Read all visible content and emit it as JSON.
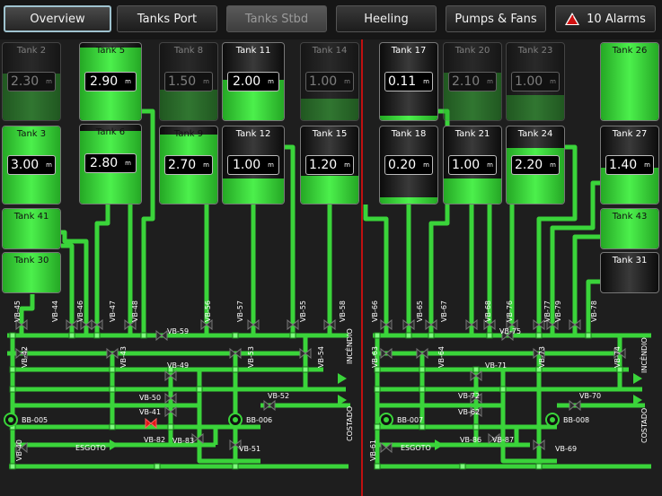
{
  "tabs": {
    "overview": "Overview",
    "tanks_port": "Tanks Port",
    "tanks_stbd": "Tanks Stbd",
    "heeling": "Heeling",
    "pumps_fans": "Pumps & Fans",
    "alarms": "10 Alarms"
  },
  "unit": "m",
  "tanks": {
    "t2": {
      "name": "Tank 2",
      "value": "2.30"
    },
    "t5": {
      "name": "Tank 5",
      "value": "2.90"
    },
    "t8": {
      "name": "Tank 8",
      "value": "1.50"
    },
    "t11": {
      "name": "Tank 11",
      "value": "2.00"
    },
    "t14": {
      "name": "Tank 14",
      "value": "1.00"
    },
    "t17": {
      "name": "Tank 17",
      "value": "0.11"
    },
    "t20": {
      "name": "Tank 20",
      "value": "2.10"
    },
    "t23": {
      "name": "Tank 23",
      "value": "1.00"
    },
    "t26": {
      "name": "Tank 26"
    },
    "t3": {
      "name": "Tank 3",
      "value": "3.00"
    },
    "t6": {
      "name": "Tank 6",
      "value": "2.80"
    },
    "t9": {
      "name": "Tank 9",
      "value": "2.70"
    },
    "t12": {
      "name": "Tank 12",
      "value": "1.00"
    },
    "t15": {
      "name": "Tank 15",
      "value": "1.20"
    },
    "t18": {
      "name": "Tank 18",
      "value": "0.20"
    },
    "t21": {
      "name": "Tank 21",
      "value": "1.00"
    },
    "t24": {
      "name": "Tank 24",
      "value": "2.20"
    },
    "t27": {
      "name": "Tank 27",
      "value": "1.40"
    },
    "t41": {
      "name": "Tank 41"
    },
    "t43": {
      "name": "Tank 43"
    },
    "t30": {
      "name": "Tank 30"
    },
    "t31": {
      "name": "Tank 31"
    }
  },
  "valves_left": [
    "VB-45",
    "VB-44",
    "VB-46",
    "VB-47",
    "VB-48",
    "VB-56",
    "VB-57",
    "VB-55",
    "VB-58",
    "VB-59",
    "VB-42",
    "VB-43",
    "VB-53",
    "VB-54",
    "VB-49",
    "VB-50",
    "VB-41",
    "VB-52",
    "VB-82",
    "VB-83",
    "VB-51",
    "VB-40"
  ],
  "valves_right": [
    "VB-66",
    "VB-65",
    "VB-67",
    "VB-68",
    "VB-76",
    "VB-77",
    "VB-79",
    "VB-78",
    "VB-75",
    "VB-63",
    "VB-64",
    "VB-73",
    "VB-74",
    "VB-71",
    "VB-72",
    "VB-62",
    "VB-70",
    "VB-86",
    "VB-87",
    "VB-69",
    "VB-61"
  ],
  "pumps": {
    "bb005": "BB-005",
    "bb006": "BB-006",
    "bb007": "BB-007",
    "bb008": "BB-008"
  },
  "outlets": {
    "esgoto_left": "ESGOTO",
    "esgoto_right": "ESGOTO",
    "incendio_left": "INCÊNDIO",
    "incendio_right": "INCÊNDIO",
    "costado_left": "COSTADO",
    "costado_right": "COSTADO"
  },
  "colors": {
    "pipe": "#3ad43a",
    "alarm": "#d01010",
    "divider": "#c01010",
    "valve_open": "#3ad43a",
    "valve_closed": "#e01818"
  }
}
